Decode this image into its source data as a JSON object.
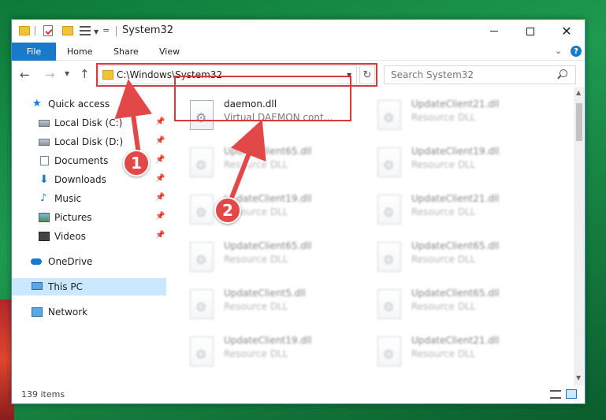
{
  "window": {
    "title": "System32",
    "customize_label": "=",
    "minimize_label": "Minimize",
    "maximize_label": "Maximize",
    "close_label": "✕"
  },
  "ribbon": {
    "file": "File",
    "home": "Home",
    "share": "Share",
    "view": "View",
    "help": "?"
  },
  "address": {
    "path": "C:\\Windows\\System32",
    "refresh": "↻"
  },
  "search": {
    "placeholder": "Search System32"
  },
  "nav": {
    "quick_access": "Quick access",
    "items": [
      {
        "label": "Local Disk (C:)"
      },
      {
        "label": "Local Disk (D:)"
      },
      {
        "label": "Documents"
      },
      {
        "label": "Downloads"
      },
      {
        "label": "Music"
      },
      {
        "label": "Pictures"
      },
      {
        "label": "Videos"
      }
    ],
    "onedrive": "OneDrive",
    "this_pc": "This PC",
    "network": "Network"
  },
  "files": {
    "target": {
      "name": "daemon.dll",
      "desc": "Virtual DAEMON cont..."
    },
    "left_column": [
      {
        "name": "UpdateClient65.dll",
        "desc": "Resource DLL"
      },
      {
        "name": "UpdateClient19.dll",
        "desc": "Resource DLL"
      },
      {
        "name": "UpdateClient65.dll",
        "desc": "Resource DLL"
      },
      {
        "name": "UpdateClient5.dll",
        "desc": "Resource DLL"
      },
      {
        "name": "UpdateClient19.dll",
        "desc": "Resource DLL"
      }
    ],
    "right_column": [
      {
        "name": "UpdateClient21.dll",
        "desc": "Resource DLL"
      },
      {
        "name": "UpdateClient19.dll",
        "desc": "Resource DLL"
      },
      {
        "name": "UpdateClient21.dll",
        "desc": "Resource DLL"
      },
      {
        "name": "UpdateClient65.dll",
        "desc": "Resource DLL"
      },
      {
        "name": "UpdateClient65.dll",
        "desc": "Resource DLL"
      },
      {
        "name": "UpdateClient21.dll",
        "desc": "Resource DLL"
      }
    ]
  },
  "status": {
    "count": "139 items"
  },
  "annotations": {
    "step1": "1",
    "step2": "2"
  },
  "colors": {
    "accent": "#1979ca",
    "highlight": "#d63a3a",
    "selection": "#cce8ff"
  }
}
